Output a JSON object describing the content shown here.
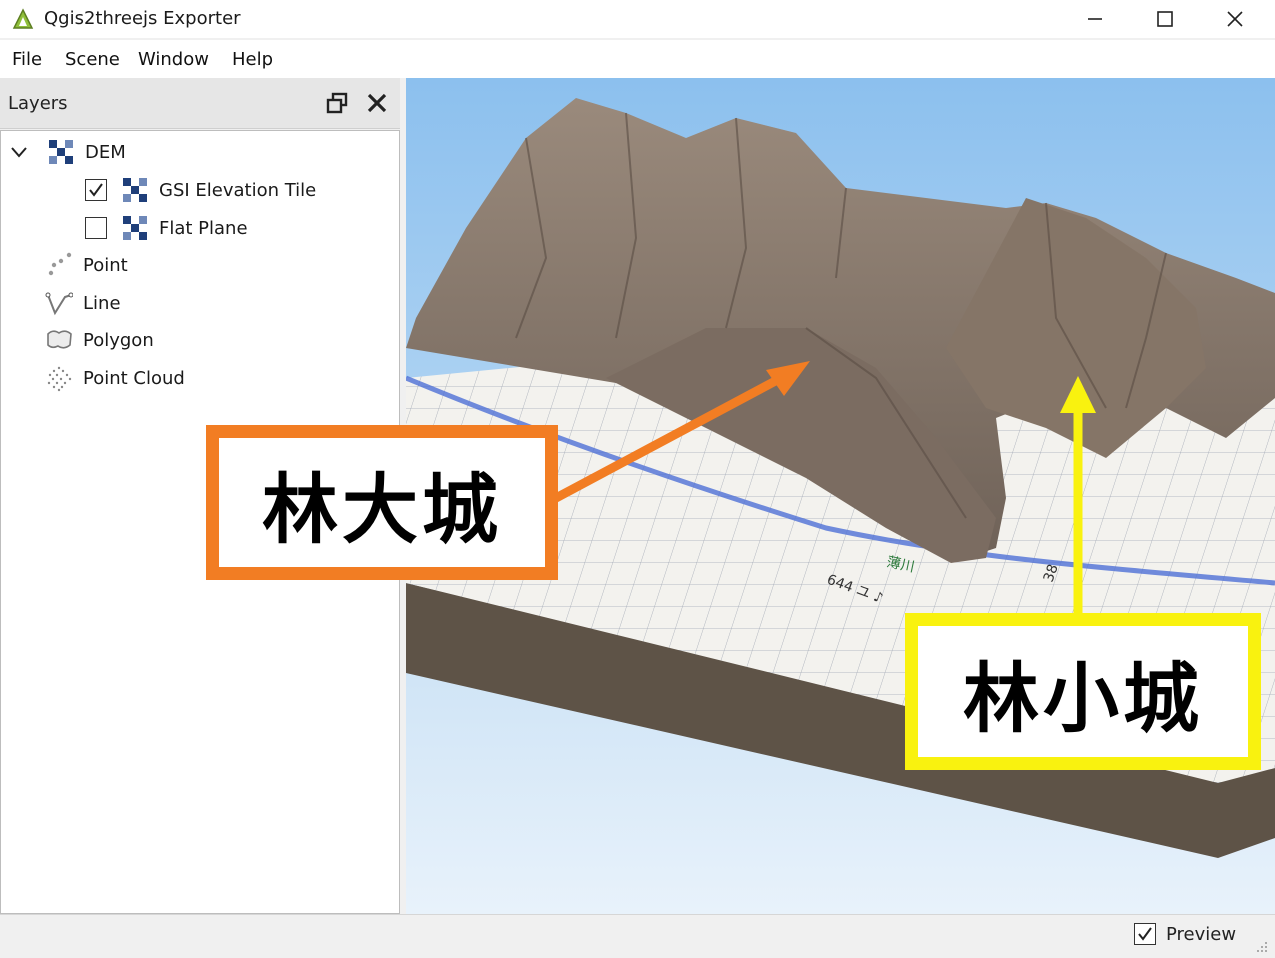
{
  "window": {
    "title": "Qgis2threejs Exporter",
    "icon": "qgis-triangle-icon",
    "controls": [
      "minimize-icon",
      "maximize-icon",
      "close-icon"
    ]
  },
  "menu": {
    "items": [
      "File",
      "Scene",
      "Window",
      "Help"
    ]
  },
  "layers_panel": {
    "title": "Layers",
    "tree": {
      "dem_group": {
        "label": "DEM",
        "expanded": true,
        "icon": "raster-icon"
      },
      "dem_children": [
        {
          "label": "GSI Elevation Tile",
          "checked": true,
          "icon": "raster-icon"
        },
        {
          "label": "Flat Plane",
          "checked": false,
          "icon": "raster-icon"
        }
      ],
      "groups": [
        {
          "label": "Point",
          "icon": "point-layer-icon"
        },
        {
          "label": "Line",
          "icon": "line-layer-icon"
        },
        {
          "label": "Polygon",
          "icon": "polygon-layer-icon"
        },
        {
          "label": "Point Cloud",
          "icon": "point-cloud-icon"
        }
      ]
    }
  },
  "viewport": {
    "annotations": [
      {
        "text": "林大城",
        "color": "#f27d23"
      },
      {
        "text": "林小城",
        "color": "#f9f20f"
      }
    ],
    "map_labels": [
      "644 ユ ♪",
      "薄川",
      "38"
    ]
  },
  "status": {
    "preview_label": "Preview",
    "preview_checked": true
  },
  "colors": {
    "sky_top": "#8cc0ee",
    "terrain_base": "#5e5347",
    "terrain": "#8a7a6c",
    "annotation_orange": "#f27d23",
    "annotation_yellow": "#f9f20f"
  }
}
